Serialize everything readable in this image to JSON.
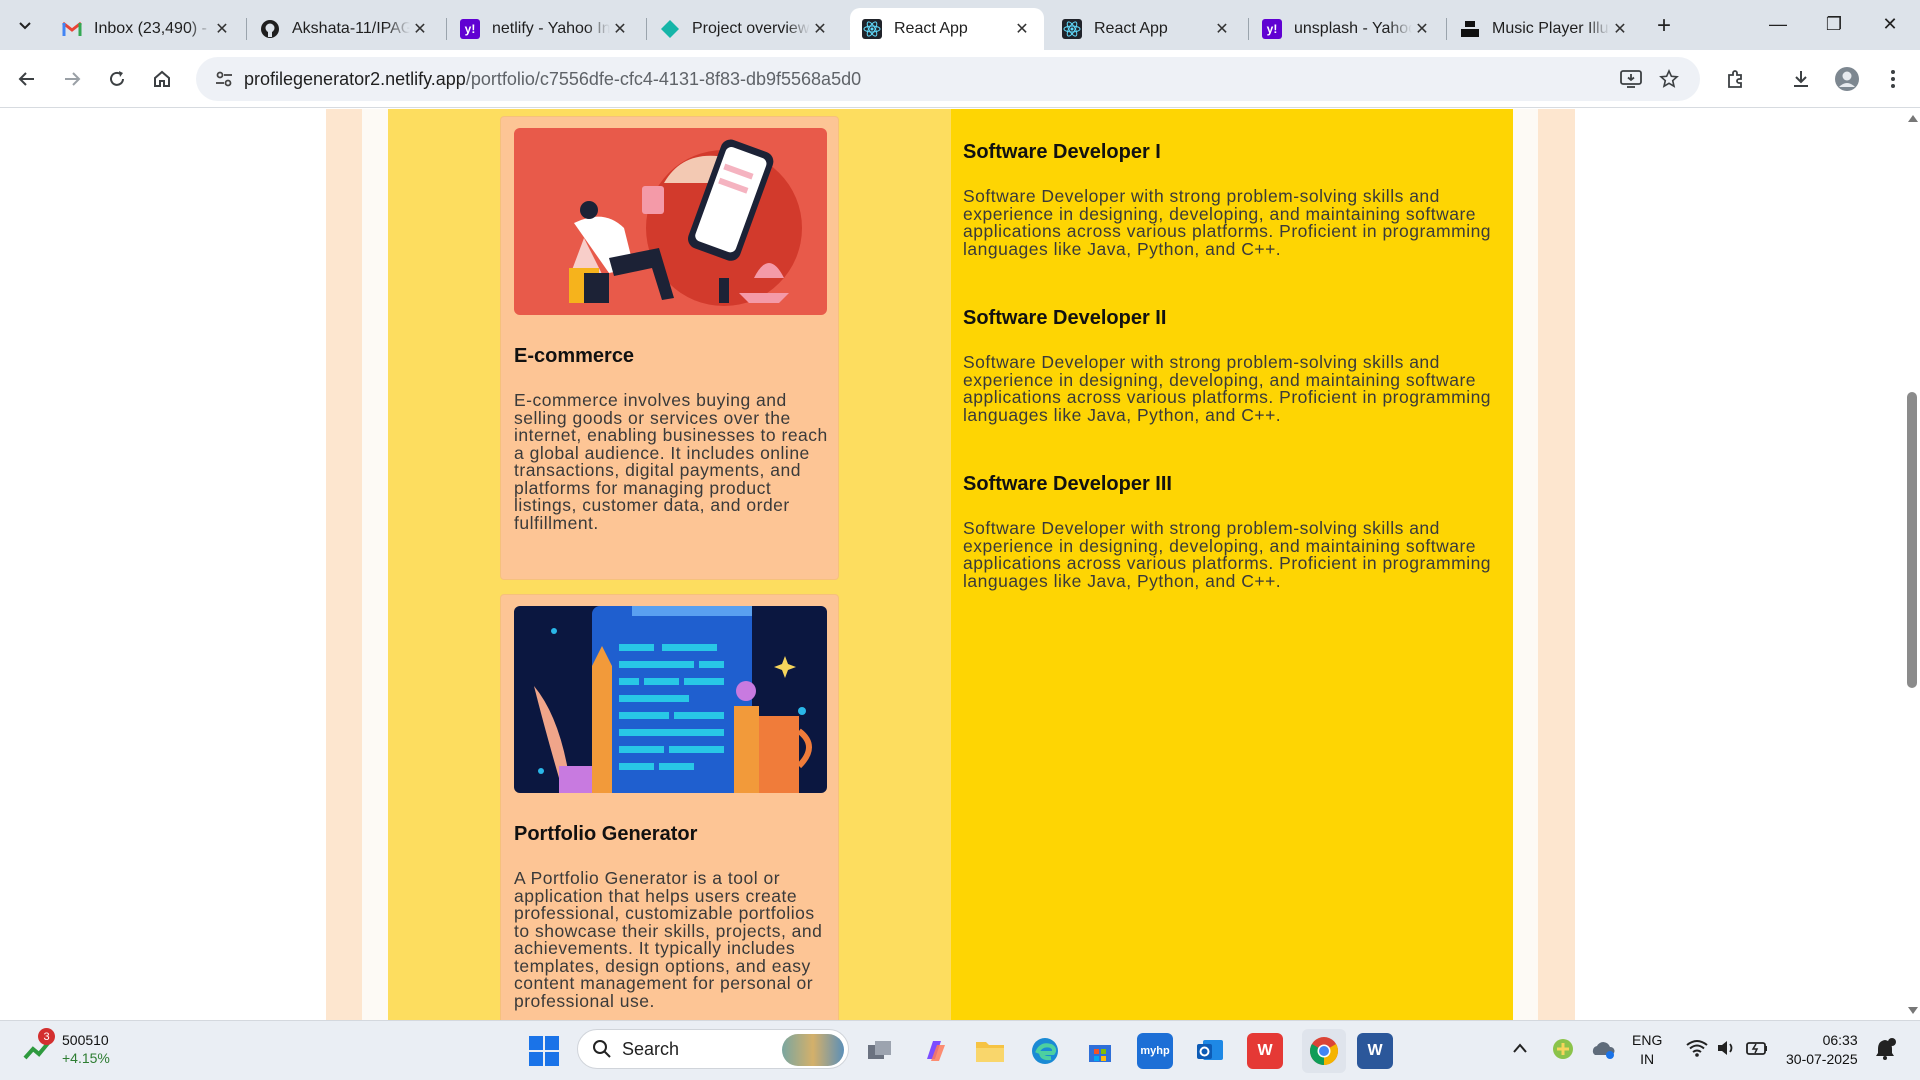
{
  "browser": {
    "tabs": [
      {
        "title": "Inbox (23,490) - a",
        "icon": "gmail-icon"
      },
      {
        "title": "Akshata-11/IPAG",
        "icon": "github-icon"
      },
      {
        "title": "netlify - Yahoo In",
        "icon": "yahoo-icon"
      },
      {
        "title": "Project overview",
        "icon": "netlify-icon"
      },
      {
        "title": "React App",
        "icon": "react-icon",
        "active": true
      },
      {
        "title": "React App",
        "icon": "react-icon"
      },
      {
        "title": "unsplash - Yahoo",
        "icon": "yahoo-icon"
      },
      {
        "title": "Music Player Illus",
        "icon": "unsplash-icon"
      }
    ],
    "url_host": "profilegenerator2.netlify.app",
    "url_path": "/portfolio/c7556dfe-cfc4-4131-8f83-db9f5568a5d0"
  },
  "projects": [
    {
      "title": "E-commerce",
      "description": "E-commerce involves buying and selling goods or services over the internet, enabling businesses to reach a global audience. It includes online transactions, digital payments, and platforms for managing product listings, customer data, and order fulfillment."
    },
    {
      "title": "Portfolio Generator",
      "description": "A Portfolio Generator is a tool or application that helps users create professional, customizable portfolios to showcase their skills, projects, and achievements. It typically includes templates, design options, and easy content management for personal or professional use."
    }
  ],
  "experience": [
    {
      "title": "Software Developer I",
      "description": "Software Developer with strong problem-solving skills and experience in designing, developing, and maintaining software applications across various platforms. Proficient in programming languages like Java, Python, and C++."
    },
    {
      "title": "Software Developer II",
      "description": "Software Developer with strong problem-solving skills and experience in designing, developing, and maintaining software applications across various platforms. Proficient in programming languages like Java, Python, and C++."
    },
    {
      "title": "Software Developer III",
      "description": "Software Developer with strong problem-solving skills and experience in designing, developing, and maintaining software applications across various platforms. Proficient in programming languages like Java, Python, and C++."
    }
  ],
  "taskbar": {
    "stock_badge": "3",
    "stock_value": "500510",
    "stock_change": "+4.15%",
    "search_label": "Search",
    "lang_top": "ENG",
    "lang_bottom": "IN",
    "time": "06:33",
    "date": "30-07-2025"
  },
  "colors": {
    "outer_bg": "#fde6cf",
    "left_panel": "#fddd5f",
    "right_panel": "#fed503",
    "card_bg": "#fdc595"
  }
}
